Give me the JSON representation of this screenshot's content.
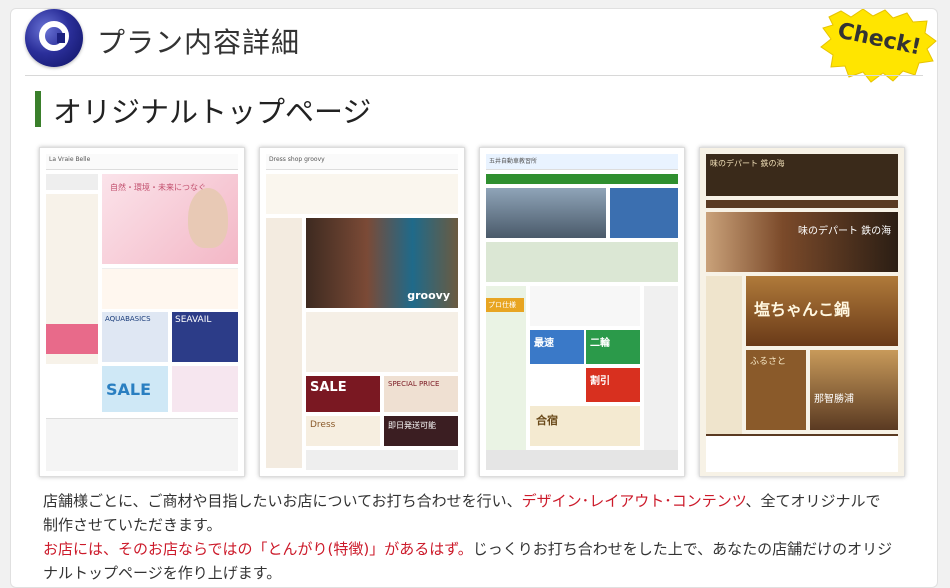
{
  "header": {
    "title": "プラン内容詳細",
    "badge": "Check!",
    "logo_icon": "moon-logo-icon"
  },
  "section": {
    "subtitle": "オリジナルトップページ",
    "accent": "#3a7f2b"
  },
  "thumbnails": [
    {
      "site": "La Vraie Belle",
      "tagline": "自然・環境・未来につなぐ",
      "banner1": "AQUABASICS",
      "banner2": "SEAVAIL",
      "banner3": "SALE"
    },
    {
      "site": "Dress shop groovy",
      "tagline": "groovy",
      "banner1": "SALE",
      "banner2": "SPECIAL PRICE",
      "banner3": "即日発送可能",
      "banner4": "Dress"
    },
    {
      "site": "五井自動車教習所",
      "tagline": "プロ仕様",
      "banner1": "最速",
      "banner2": "二輪",
      "banner3": "割引",
      "banner4": "合宿"
    },
    {
      "site": "味のデパート 鉄の海",
      "tagline": "塩ちゃんこ鍋",
      "banner1": "味のデパート 鉄の海",
      "banner2": "ふるさと",
      "banner3": "那智勝浦"
    }
  ],
  "caption": {
    "line1_a": "店舗様ごとに、ご商材や目指したいお店についてお打ち合わせを行い、",
    "line1_red1": "デザイン",
    "line1_dot1": "･",
    "line1_red2": "レイアウト",
    "line1_dot2": "･",
    "line1_red3": "コンテンツ",
    "line1_b": "、全てオリジナルで",
    "line2": "制作させていただきます。",
    "line3_red": "お店には、そのお店ならではの「とんがり(特徴)」があるはず。",
    "line3_b": "じっくりお打ち合わせをした上で、あなたの店舗だけのオリジ",
    "line4": "ナルトップページを作り上げます。"
  },
  "colors": {
    "red": "#cc1a2a",
    "badge": "#ffe500",
    "panel": "#ffffff"
  }
}
